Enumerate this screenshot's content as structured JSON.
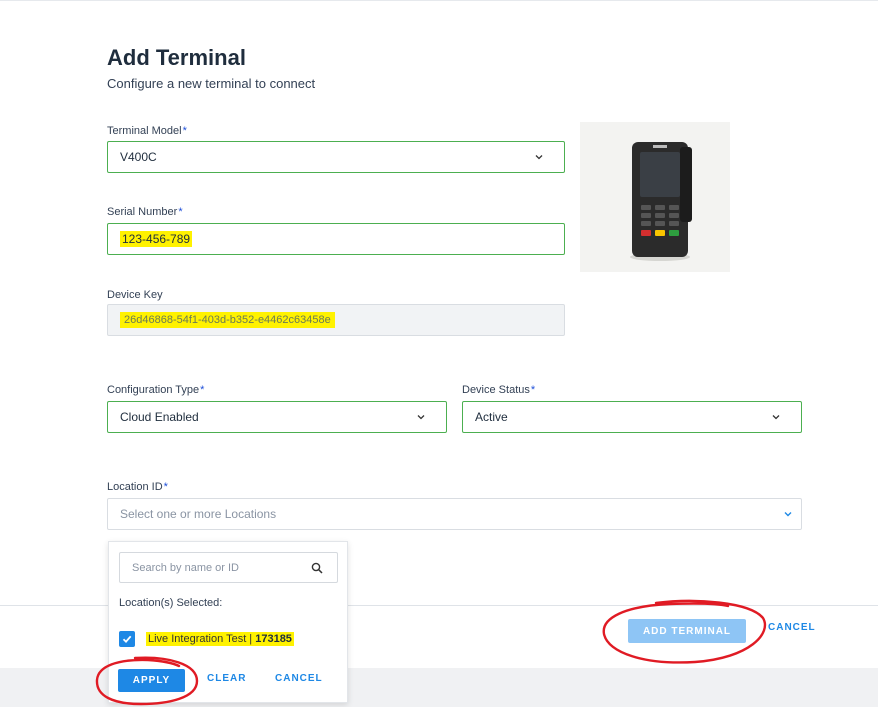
{
  "header": {
    "title": "Add Terminal",
    "subtitle": "Configure a new terminal to connect"
  },
  "form": {
    "terminal_model": {
      "label": "Terminal Model",
      "required_mark": "*",
      "value": "V400C"
    },
    "serial_number": {
      "label": "Serial Number",
      "required_mark": "*",
      "value": "123-456-789"
    },
    "device_key": {
      "label": "Device Key",
      "value": "26d46868-54f1-403d-b352-e4462c63458e"
    },
    "configuration_type": {
      "label": "Configuration Type",
      "required_mark": "*",
      "value": "Cloud Enabled"
    },
    "device_status": {
      "label": "Device Status",
      "required_mark": "*",
      "value": "Active"
    },
    "location_id": {
      "label": "Location ID",
      "required_mark": "*",
      "placeholder": "Select one or more Locations"
    }
  },
  "location_dropdown": {
    "search_placeholder": "Search by name or ID",
    "selected_heading": "Location(s) Selected:",
    "selected_item_name": "Live Integration Test | ",
    "selected_item_id": "173185",
    "apply_label": "APPLY",
    "clear_label": "CLEAR",
    "cancel_label": "CANCEL"
  },
  "footer": {
    "add_terminal_label": "ADD TERMINAL",
    "cancel_label": "CANCEL"
  },
  "colors": {
    "accent": "#1e88e5",
    "valid_border": "#4caf50",
    "highlight": "#fff200",
    "annotation": "#e01b24",
    "disabled_button": "#8ec5f5"
  },
  "icons": [
    "chevron-down-icon",
    "search-icon",
    "checkbox-checked-icon",
    "payment-terminal-image"
  ]
}
